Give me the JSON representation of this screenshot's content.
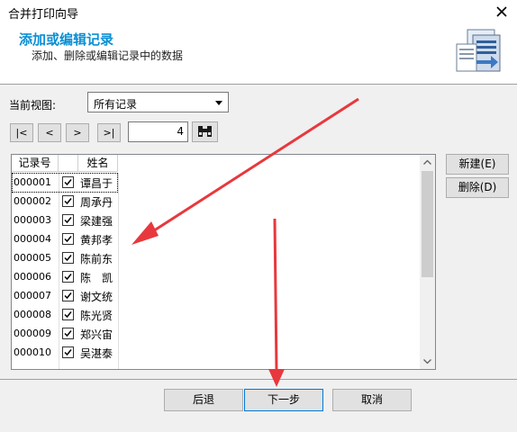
{
  "window": {
    "title": "合并打印向导"
  },
  "header": {
    "title": "添加或编辑记录",
    "subtitle": "添加、删除或编辑记录中的数据",
    "accent_color": "#0b8fd4",
    "icon": "records-document-icon"
  },
  "view": {
    "label": "当前视图:",
    "selected": "所有记录"
  },
  "navigation": {
    "first_label": "|<",
    "prev_label": "<",
    "next_label": ">",
    "last_label": ">|",
    "current_record": "4",
    "find_icon": "binoculars-icon"
  },
  "table": {
    "columns": [
      "记录号",
      "姓名"
    ],
    "rows": [
      {
        "id": "000001",
        "checked": true,
        "name": "谭昌于"
      },
      {
        "id": "000002",
        "checked": true,
        "name": "周承丹"
      },
      {
        "id": "000003",
        "checked": true,
        "name": "梁建强"
      },
      {
        "id": "000004",
        "checked": true,
        "name": "黄邦孝"
      },
      {
        "id": "000005",
        "checked": true,
        "name": "陈前东"
      },
      {
        "id": "000006",
        "checked": true,
        "name": "陈　凯"
      },
      {
        "id": "000007",
        "checked": true,
        "name": "谢文统"
      },
      {
        "id": "000008",
        "checked": true,
        "name": "陈光贤"
      },
      {
        "id": "000009",
        "checked": true,
        "name": "郑兴宙"
      },
      {
        "id": "000010",
        "checked": true,
        "name": "吴湛泰"
      }
    ]
  },
  "side_buttons": {
    "new": "新建(E)",
    "delete": "删除(D)"
  },
  "footer": {
    "back": "后退",
    "next": "下一步",
    "cancel": "取消"
  },
  "annotation": {
    "arrow_color": "#e8383d"
  }
}
